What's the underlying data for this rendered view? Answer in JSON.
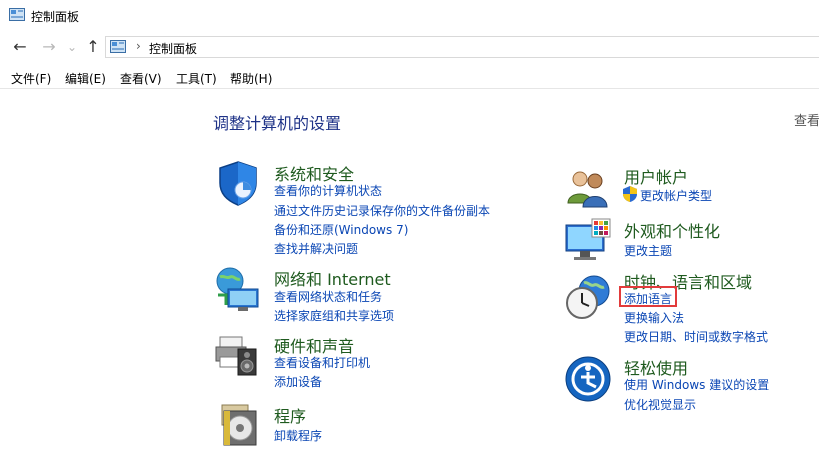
{
  "window": {
    "title": "控制面板"
  },
  "address": {
    "crumb": "控制面板",
    "separator": "›"
  },
  "nav": {
    "back": "←",
    "forward": "→",
    "recent": "⌄",
    "up": "↑"
  },
  "menu": {
    "file": "文件(F)",
    "edit": "编辑(E)",
    "view": "查看(V)",
    "tools": "工具(T)",
    "help": "帮助(H)"
  },
  "main": {
    "heading": "调整计算机的设置",
    "view_by": "查看"
  },
  "left_categories": [
    {
      "title": "系统和安全",
      "icon": "shield-icon",
      "links": [
        "查看你的计算机状态",
        "通过文件历史记录保存你的文件备份副本",
        "备份和还原(Windows 7)",
        "查找并解决问题"
      ]
    },
    {
      "title": "网络和 Internet",
      "icon": "network-globe-icon",
      "links": [
        "查看网络状态和任务",
        "选择家庭组和共享选项"
      ]
    },
    {
      "title": "硬件和声音",
      "icon": "printer-speaker-icon",
      "links": [
        "查看设备和打印机",
        "添加设备"
      ]
    },
    {
      "title": "程序",
      "icon": "programs-disc-icon",
      "links": [
        "卸载程序"
      ]
    }
  ],
  "right_categories": [
    {
      "title": "用户帐户",
      "icon": "users-icon",
      "links": [
        "更改帐户类型"
      ]
    },
    {
      "title": "外观和个性化",
      "icon": "monitor-palette-icon",
      "links": [
        "更改主题"
      ]
    },
    {
      "title": "时钟、语言和区域",
      "icon": "clock-globe-icon",
      "links": [
        "添加语言",
        "更换输入法",
        "更改日期、时间或数字格式"
      ]
    },
    {
      "title": "轻松使用",
      "icon": "ease-of-access-icon",
      "links": [
        "使用 Windows 建议的设置",
        "优化视觉显示"
      ]
    }
  ],
  "colors": {
    "heading": "#1e3287",
    "category_title": "#1e5a1e",
    "link": "#0a46b4",
    "highlight_border": "#e23b3b"
  }
}
